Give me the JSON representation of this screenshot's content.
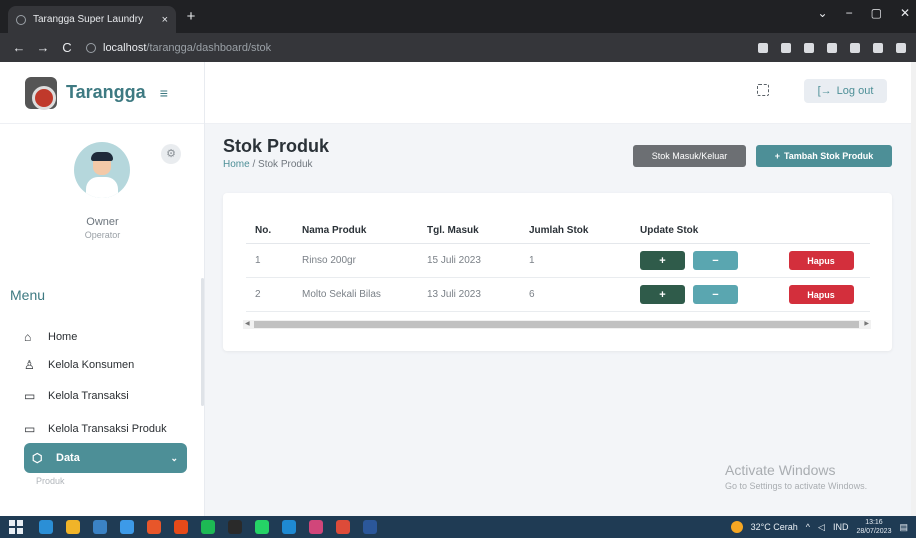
{
  "browser": {
    "tab_title": "Tarangga Super Laundry",
    "tab_close": "×",
    "new_tab": "+",
    "url_host": "localhost",
    "url_path": "/tarangga/dashboard/stok",
    "window_controls": [
      "⌄",
      "−",
      "▢",
      "✕"
    ]
  },
  "brand": {
    "name": "Tarangga",
    "hamburger": "≡"
  },
  "profile": {
    "name": "Owner",
    "role": "Operator"
  },
  "menu": {
    "title": "Menu",
    "items": [
      {
        "label": "Home",
        "icon": "⌂"
      },
      {
        "label": "Kelola Konsumen",
        "icon": "♙"
      },
      {
        "label": "Kelola Transaksi",
        "icon": "▭"
      },
      {
        "label": "Kelola Transaksi Produk",
        "icon": "▭"
      }
    ],
    "active": {
      "label": "Data",
      "icon": "⬡",
      "chevron": "⌄"
    },
    "faded": "Produk"
  },
  "topbar": {
    "logout_label": "Log out",
    "logout_icon": "[→"
  },
  "page": {
    "title": "Stok Produk",
    "breadcrumb_home": "Home",
    "breadcrumb_sep": " / ",
    "breadcrumb_current": "Stok Produk",
    "btn_stock": "Stok Masuk/Keluar",
    "btn_add": "Tambah Stok Produk",
    "btn_add_icon": "+"
  },
  "table": {
    "headers": [
      "No.",
      "Nama Produk",
      "Tgl. Masuk",
      "Jumlah Stok",
      "Update Stok",
      ""
    ],
    "rows": [
      {
        "no": "1",
        "name": "Rinso 200gr",
        "date": "15 Juli 2023",
        "qty": "1",
        "plus": "+",
        "minus": "−",
        "delete": "Hapus"
      },
      {
        "no": "2",
        "name": "Molto Sekali Bilas",
        "date": "13 Juli 2023",
        "qty": "6",
        "plus": "+",
        "minus": "−",
        "delete": "Hapus"
      }
    ]
  },
  "watermark": {
    "line1": "Activate Windows",
    "line2": "Go to Settings to activate Windows."
  },
  "taskbar": {
    "weather": "32°C Cerah",
    "lang": "IND",
    "time": "13:16",
    "date": "28/07/2023"
  },
  "colors": {
    "accent": "#4d8f97",
    "danger": "#d32f3c",
    "success_dark": "#2f5b4a"
  }
}
